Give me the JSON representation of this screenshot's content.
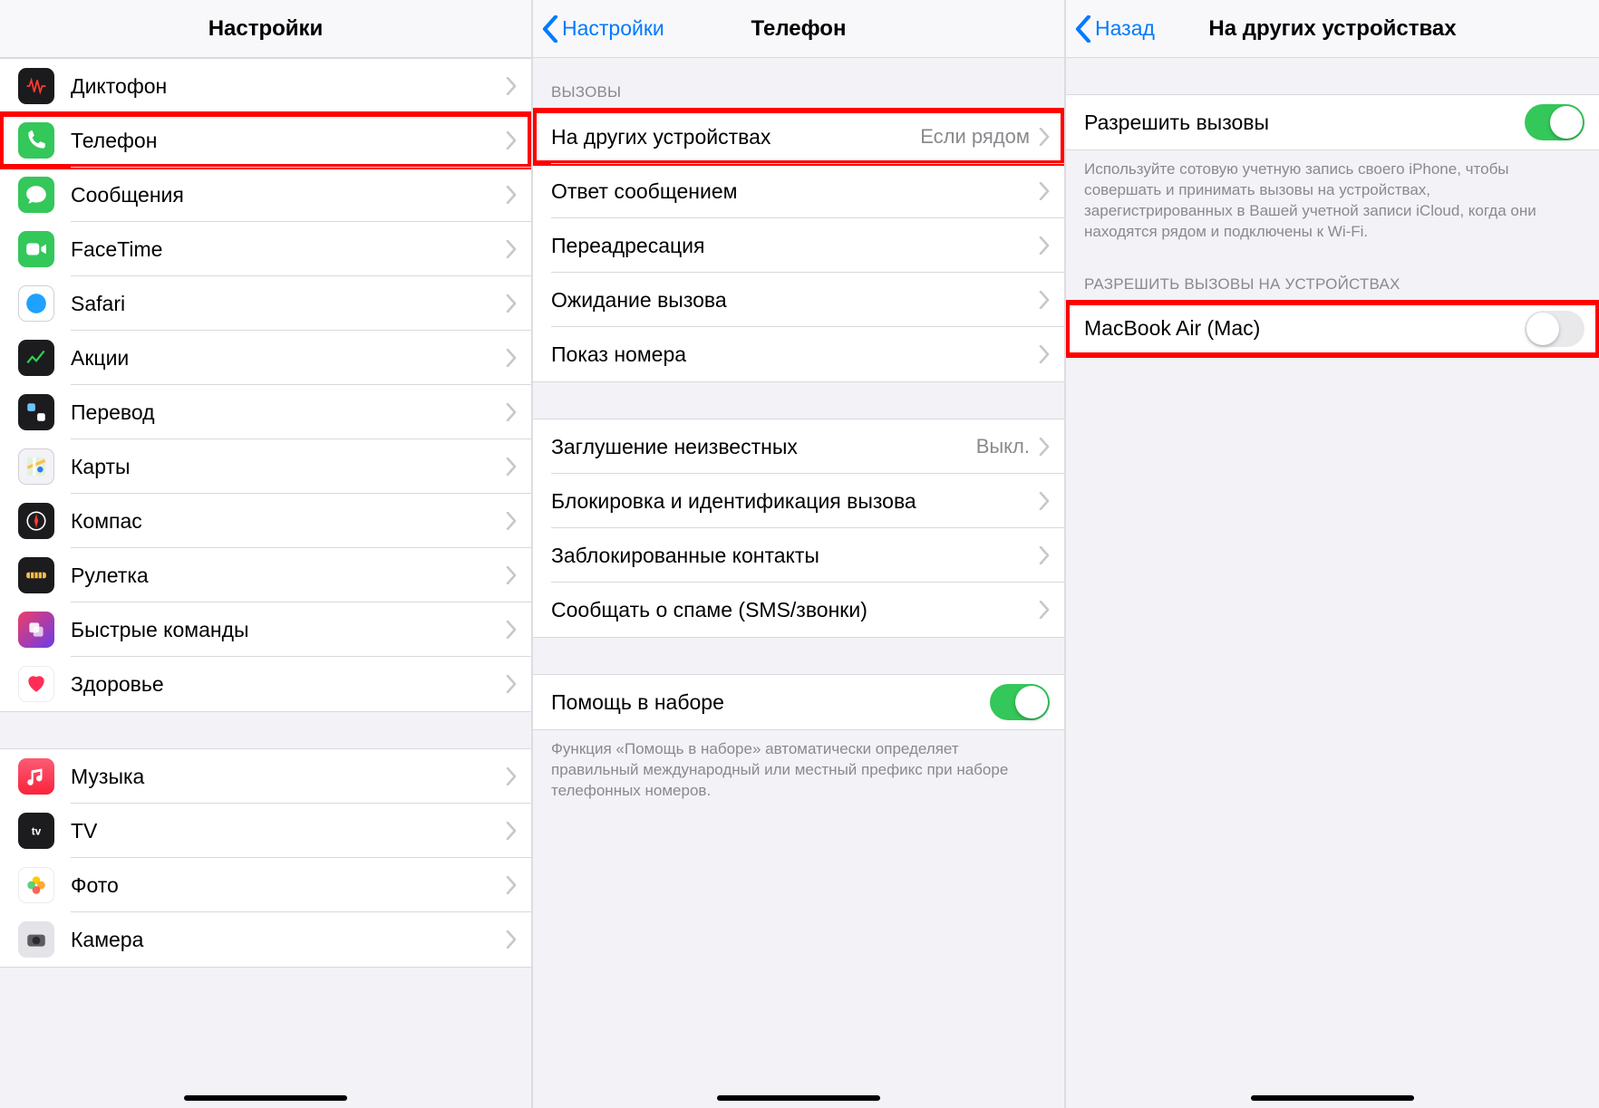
{
  "screen1": {
    "title": "Настройки",
    "items": [
      {
        "label": "Диктофон",
        "icon": "voice-memos-icon"
      },
      {
        "label": "Телефон",
        "icon": "phone-icon",
        "highlighted": true
      },
      {
        "label": "Сообщения",
        "icon": "messages-icon"
      },
      {
        "label": "FaceTime",
        "icon": "facetime-icon"
      },
      {
        "label": "Safari",
        "icon": "safari-icon"
      },
      {
        "label": "Акции",
        "icon": "stocks-icon"
      },
      {
        "label": "Перевод",
        "icon": "translate-icon"
      },
      {
        "label": "Карты",
        "icon": "maps-icon"
      },
      {
        "label": "Компас",
        "icon": "compass-icon"
      },
      {
        "label": "Рулетка",
        "icon": "measure-icon"
      },
      {
        "label": "Быстрые команды",
        "icon": "shortcuts-icon"
      },
      {
        "label": "Здоровье",
        "icon": "health-icon"
      }
    ],
    "items2": [
      {
        "label": "Музыка",
        "icon": "music-icon"
      },
      {
        "label": "TV",
        "icon": "tv-icon"
      },
      {
        "label": "Фото",
        "icon": "photos-icon"
      },
      {
        "label": "Камера",
        "icon": "camera-icon"
      }
    ]
  },
  "screen2": {
    "back": "Настройки",
    "title": "Телефон",
    "groups": {
      "calls_header": "ВЫЗОВЫ",
      "calls": [
        {
          "label": "На других устройствах",
          "value": "Если рядом",
          "highlighted": true
        },
        {
          "label": "Ответ сообщением"
        },
        {
          "label": "Переадресация"
        },
        {
          "label": "Ожидание вызова"
        },
        {
          "label": "Показ номера"
        }
      ],
      "silence": [
        {
          "label": "Заглушение неизвестных",
          "value": "Выкл."
        },
        {
          "label": "Блокировка и идентификация вызова"
        },
        {
          "label": "Заблокированные контакты"
        },
        {
          "label": "Сообщать о спаме (SMS/звонки)"
        }
      ],
      "assist_label": "Помощь в наборе",
      "assist_footer": "Функция «Помощь в наборе» автоматически определяет правильный международный или местный префикс при наборе телефонных номеров."
    }
  },
  "screen3": {
    "back": "Назад",
    "title": "На других устройствах",
    "allow_label": "Разрешить вызовы",
    "allow_footer": "Используйте сотовую учетную запись своего iPhone, чтобы совершать и принимать вызовы на устройствах, зарегистрированных в Вашей учетной записи iCloud, когда они находятся рядом и подключены к Wi-Fi.",
    "devices_header": "РАЗРЕШИТЬ ВЫЗОВЫ НА УСТРОЙСТВАХ",
    "devices": [
      {
        "label": "MacBook Air (Mac)",
        "on": false,
        "highlighted": true
      }
    ]
  }
}
